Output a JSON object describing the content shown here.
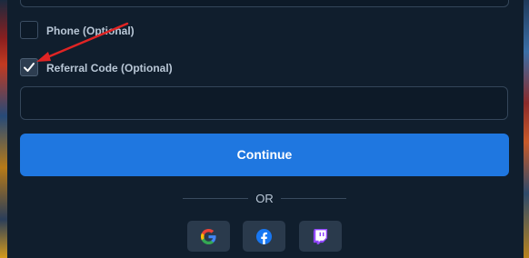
{
  "form": {
    "phone_label": "Phone (Optional)",
    "referral_label": "Referral Code (Optional)",
    "referral_value": "",
    "continue_label": "Continue",
    "divider_text": "OR",
    "phone_checked": false,
    "referral_checked": true
  },
  "social": [
    {
      "name": "google",
      "icon": "google-icon"
    },
    {
      "name": "facebook",
      "icon": "facebook-icon"
    },
    {
      "name": "twitch",
      "icon": "twitch-icon"
    }
  ],
  "colors": {
    "accent": "#1f77e0",
    "annotation_arrow": "#e02424",
    "background": "#101e2d"
  }
}
